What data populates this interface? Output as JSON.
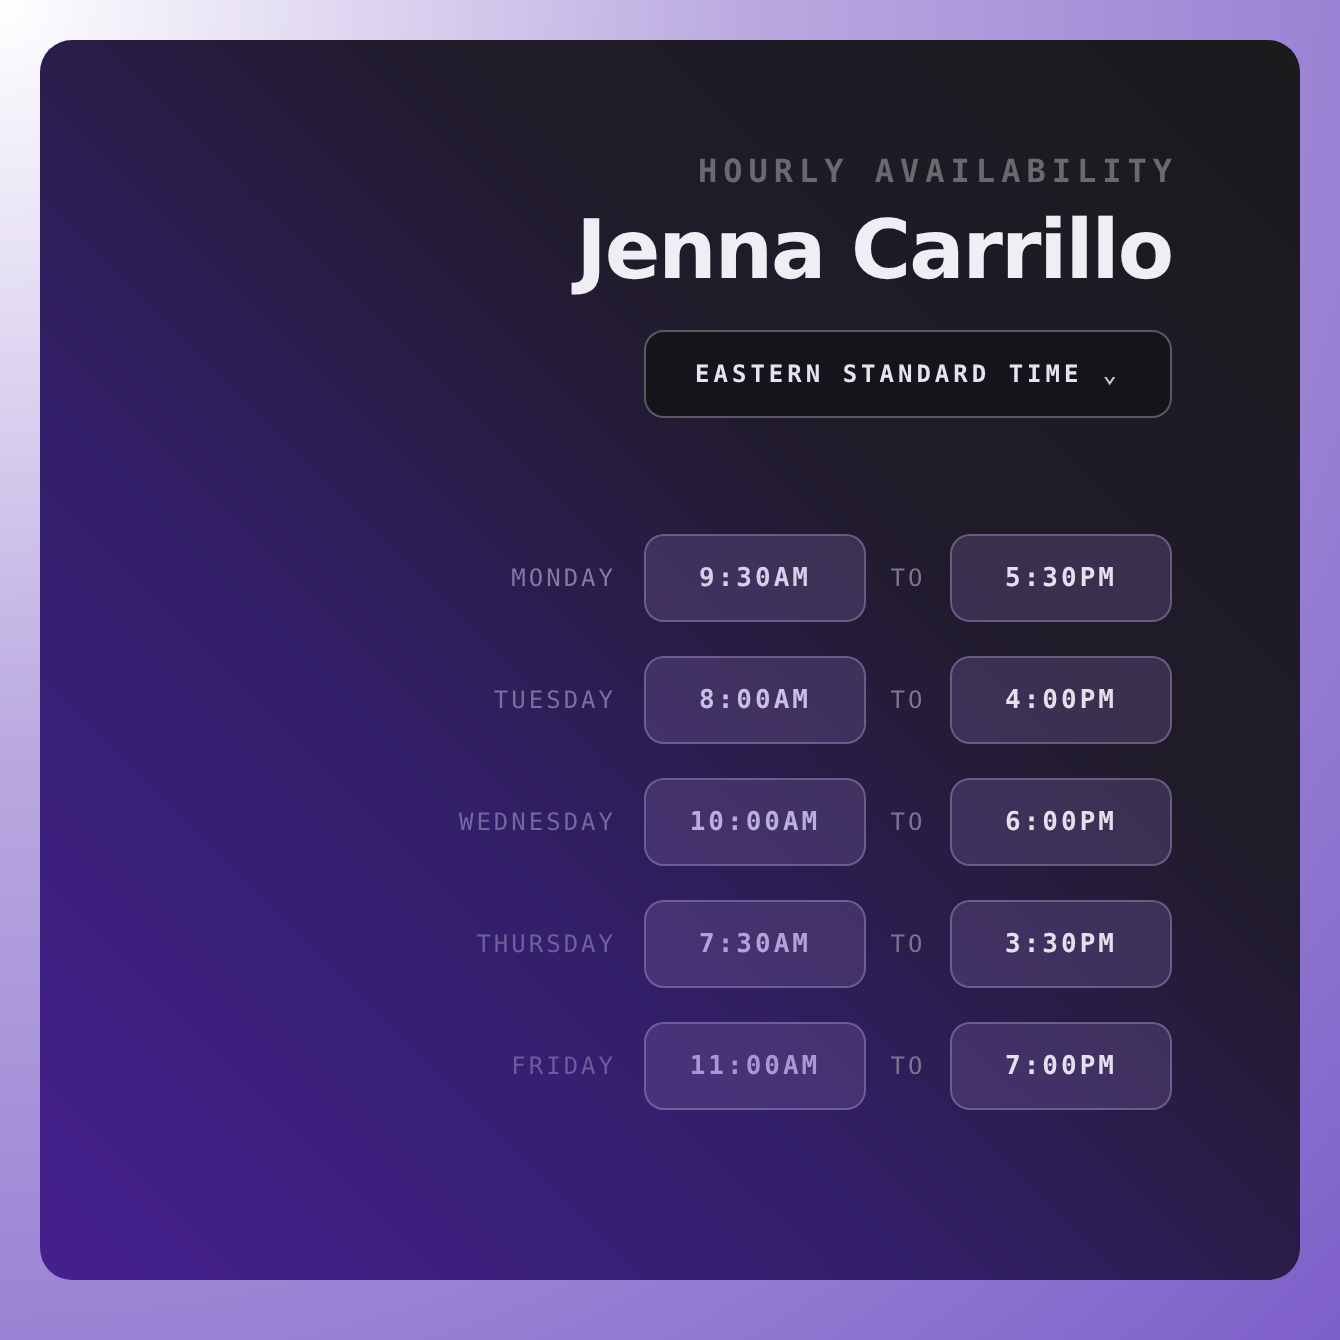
{
  "header": {
    "eyebrow": "HOURLY AVAILABILITY",
    "name": "Jenna Carrillo"
  },
  "timezone": {
    "value": "EASTERN STANDARD TIME",
    "caret": "⌄"
  },
  "days": [
    {
      "day": "MONDAY",
      "start": "9:30AM",
      "separator": "TO",
      "end": "5:30PM"
    },
    {
      "day": "TUESDAY",
      "start": "8:00AM",
      "separator": "TO",
      "end": "4:00PM"
    },
    {
      "day": "WEDNESDAY",
      "start": "10:00AM",
      "separator": "TO",
      "end": "6:00PM"
    },
    {
      "day": "THURSDAY",
      "start": "7:30AM",
      "separator": "TO",
      "end": "3:30PM"
    },
    {
      "day": "FRIDAY",
      "start": "11:00AM",
      "separator": "TO",
      "end": "7:00PM"
    }
  ]
}
